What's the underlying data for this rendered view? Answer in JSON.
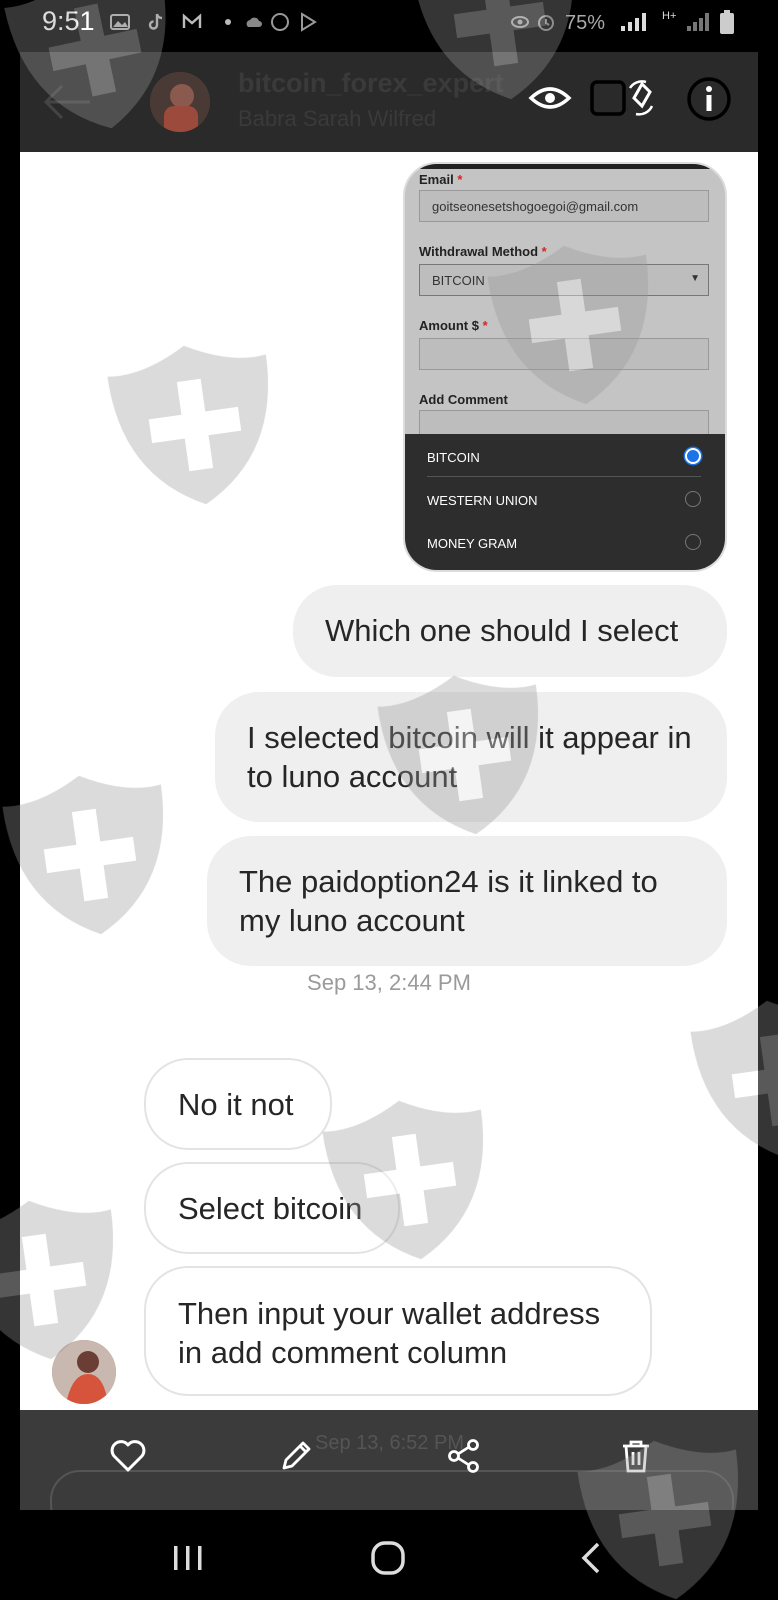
{
  "status_bar": {
    "time": "9:51",
    "battery": "75%",
    "network": "H+"
  },
  "header": {
    "username": "bitcoin_forex_expert",
    "realname": "Babra Sarah Wilfred"
  },
  "form_screenshot": {
    "email_label": "Email",
    "email_value": "goitseonesetshogoegoi@gmail.com",
    "method_label": "Withdrawal Method",
    "method_value": "BITCOIN",
    "amount_label": "Amount $",
    "comment_label": "Add Comment",
    "required_mark": "*",
    "options": [
      "BITCOIN",
      "WESTERN UNION",
      "MONEY GRAM"
    ],
    "selected_option": "BITCOIN"
  },
  "messages": {
    "sent": [
      "Which one should I select",
      "I selected bitcoin will it appear in to luno account",
      "The paidoption24 is it linked to my luno account"
    ],
    "timestamp": "Sep 13, 2:44 PM",
    "received": [
      "No it not",
      "Select bitcoin",
      "Then input your wallet address in add comment column"
    ]
  },
  "toolbar": {
    "ghost_timestamp": "Sep 13, 6:52 PM",
    "icons": [
      "heart-icon",
      "pencil-icon",
      "share-icon",
      "trash-icon"
    ]
  },
  "colors": {
    "sent_bubble": "#efefef",
    "header_bg": "#2a2a2a",
    "toolbar_bg": "#3b3b3b",
    "radio_selected": "#1a73e8"
  }
}
